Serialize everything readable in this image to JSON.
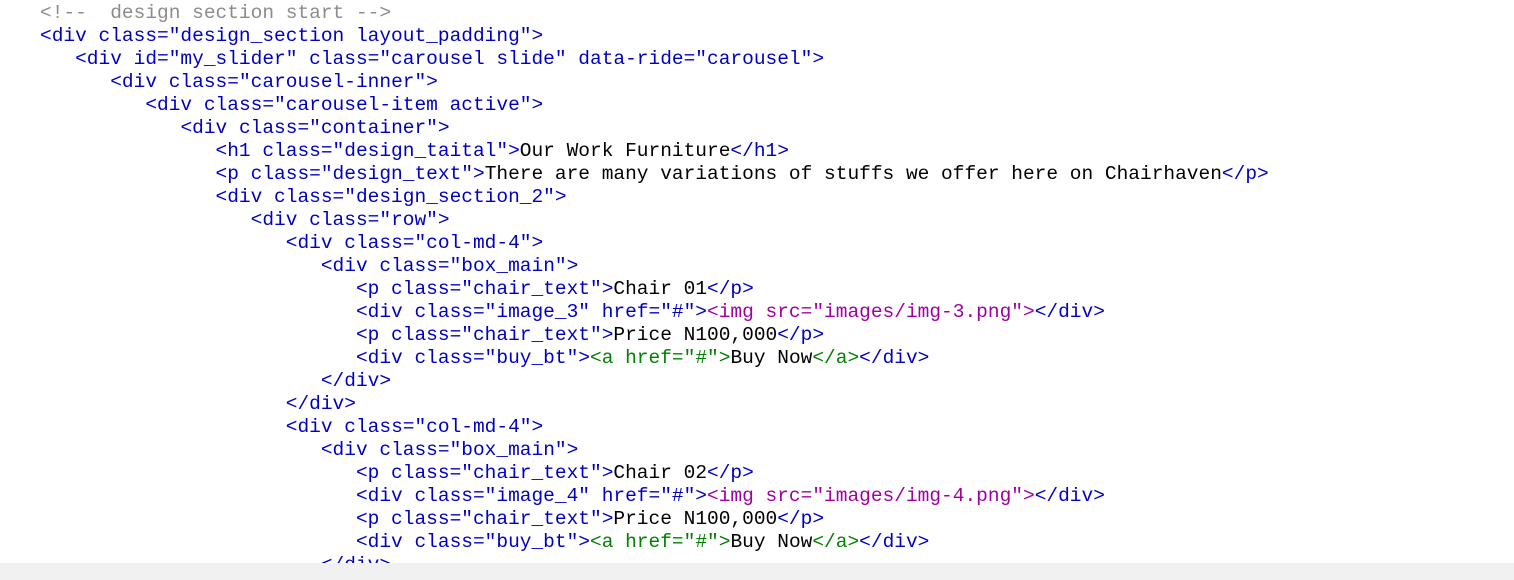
{
  "source_view": {
    "lines": [
      {
        "indent": "",
        "segments": [
          {
            "text": "<!--  design section start -->",
            "kind": "comment"
          }
        ]
      },
      {
        "indent": "",
        "segments": [
          {
            "text": "<div class=\"design_section layout_padding\">",
            "kind": "tag"
          }
        ]
      },
      {
        "indent": "   ",
        "segments": [
          {
            "text": "<div id=\"my_slider\" class=\"carousel slide\" data-ride=\"carousel\">",
            "kind": "tag"
          }
        ]
      },
      {
        "indent": "      ",
        "segments": [
          {
            "text": "<div class=\"carousel-inner\">",
            "kind": "tag"
          }
        ]
      },
      {
        "indent": "         ",
        "segments": [
          {
            "text": "<div class=\"carousel-item active\">",
            "kind": "tag"
          }
        ]
      },
      {
        "indent": "            ",
        "segments": [
          {
            "text": "<div class=\"container\">",
            "kind": "tag"
          }
        ]
      },
      {
        "indent": "               ",
        "segments": [
          {
            "text": "<h1 class=\"design_taital\">",
            "kind": "tag"
          },
          {
            "text": "Our Work Furniture",
            "kind": "text"
          },
          {
            "text": "</h1>",
            "kind": "tag"
          }
        ]
      },
      {
        "indent": "               ",
        "segments": [
          {
            "text": "<p class=\"design_text\">",
            "kind": "tag"
          },
          {
            "text": "There are many variations of stuffs we offer here on Chairhaven",
            "kind": "text"
          },
          {
            "text": "</p>",
            "kind": "tag"
          }
        ]
      },
      {
        "indent": "               ",
        "segments": [
          {
            "text": "<div class=\"design_section_2\">",
            "kind": "tag"
          }
        ]
      },
      {
        "indent": "                  ",
        "segments": [
          {
            "text": "<div class=\"row\">",
            "kind": "tag"
          }
        ]
      },
      {
        "indent": "                     ",
        "segments": [
          {
            "text": "<div class=\"col-md-4\">",
            "kind": "tag"
          }
        ]
      },
      {
        "indent": "                        ",
        "segments": [
          {
            "text": "<div class=\"box_main\">",
            "kind": "tag"
          }
        ]
      },
      {
        "indent": "                           ",
        "segments": [
          {
            "text": "<p class=\"chair_text\">",
            "kind": "tag"
          },
          {
            "text": "Chair 01",
            "kind": "text"
          },
          {
            "text": "</p>",
            "kind": "tag"
          }
        ]
      },
      {
        "indent": "                           ",
        "segments": [
          {
            "text": "<div class=\"image_3\" href=\"#\">",
            "kind": "tag"
          },
          {
            "text": "<img ",
            "kind": "inner"
          },
          {
            "text": "src=\"images/img-3.png\"",
            "kind": "inner"
          },
          {
            "text": ">",
            "kind": "inner"
          },
          {
            "text": "</div>",
            "kind": "tag"
          }
        ]
      },
      {
        "indent": "                           ",
        "segments": [
          {
            "text": "<p class=\"chair_text\">",
            "kind": "tag"
          },
          {
            "text": "Price N100,000",
            "kind": "text"
          },
          {
            "text": "</p>",
            "kind": "tag"
          }
        ]
      },
      {
        "indent": "                           ",
        "segments": [
          {
            "text": "<div class=\"buy_bt\">",
            "kind": "tag"
          },
          {
            "text": "<a ",
            "kind": "inner-attr"
          },
          {
            "text": "href=\"#\"",
            "kind": "inner-attr"
          },
          {
            "text": ">",
            "kind": "inner-attr"
          },
          {
            "text": "Buy Now",
            "kind": "text"
          },
          {
            "text": "</a>",
            "kind": "inner-attr"
          },
          {
            "text": "</div>",
            "kind": "tag"
          }
        ]
      },
      {
        "indent": "                        ",
        "segments": [
          {
            "text": "</div>",
            "kind": "tag"
          }
        ]
      },
      {
        "indent": "                     ",
        "segments": [
          {
            "text": "</div>",
            "kind": "tag"
          }
        ]
      },
      {
        "indent": "                     ",
        "segments": [
          {
            "text": "<div class=\"col-md-4\">",
            "kind": "tag"
          }
        ]
      },
      {
        "indent": "                        ",
        "segments": [
          {
            "text": "<div class=\"box_main\">",
            "kind": "tag"
          }
        ]
      },
      {
        "indent": "                           ",
        "segments": [
          {
            "text": "<p class=\"chair_text\">",
            "kind": "tag"
          },
          {
            "text": "Chair 02",
            "kind": "text"
          },
          {
            "text": "</p>",
            "kind": "tag"
          }
        ]
      },
      {
        "indent": "                           ",
        "segments": [
          {
            "text": "<div class=\"image_4\" href=\"#\">",
            "kind": "tag"
          },
          {
            "text": "<img ",
            "kind": "inner"
          },
          {
            "text": "src=\"images/img-4.png\"",
            "kind": "inner"
          },
          {
            "text": ">",
            "kind": "inner"
          },
          {
            "text": "</div>",
            "kind": "tag"
          }
        ]
      },
      {
        "indent": "                           ",
        "segments": [
          {
            "text": "<p class=\"chair_text\">",
            "kind": "tag"
          },
          {
            "text": "Price N100,000",
            "kind": "text"
          },
          {
            "text": "</p>",
            "kind": "tag"
          }
        ]
      },
      {
        "indent": "                           ",
        "segments": [
          {
            "text": "<div class=\"buy_bt\">",
            "kind": "tag"
          },
          {
            "text": "<a ",
            "kind": "inner-attr"
          },
          {
            "text": "href=\"#\"",
            "kind": "inner-attr"
          },
          {
            "text": ">",
            "kind": "inner-attr"
          },
          {
            "text": "Buy Now",
            "kind": "text"
          },
          {
            "text": "</a>",
            "kind": "inner-attr"
          },
          {
            "text": "</div>",
            "kind": "tag"
          }
        ]
      },
      {
        "indent": "                        ",
        "segments": [
          {
            "text": "</div>",
            "kind": "tag"
          }
        ]
      }
    ]
  },
  "colors": {
    "comment": "#8c8c8c",
    "tag": "#0000c0",
    "text": "#000000",
    "inner": "#a000a0",
    "inner_attr": "#008000",
    "scrollbar_track": "#f1f1f1"
  }
}
